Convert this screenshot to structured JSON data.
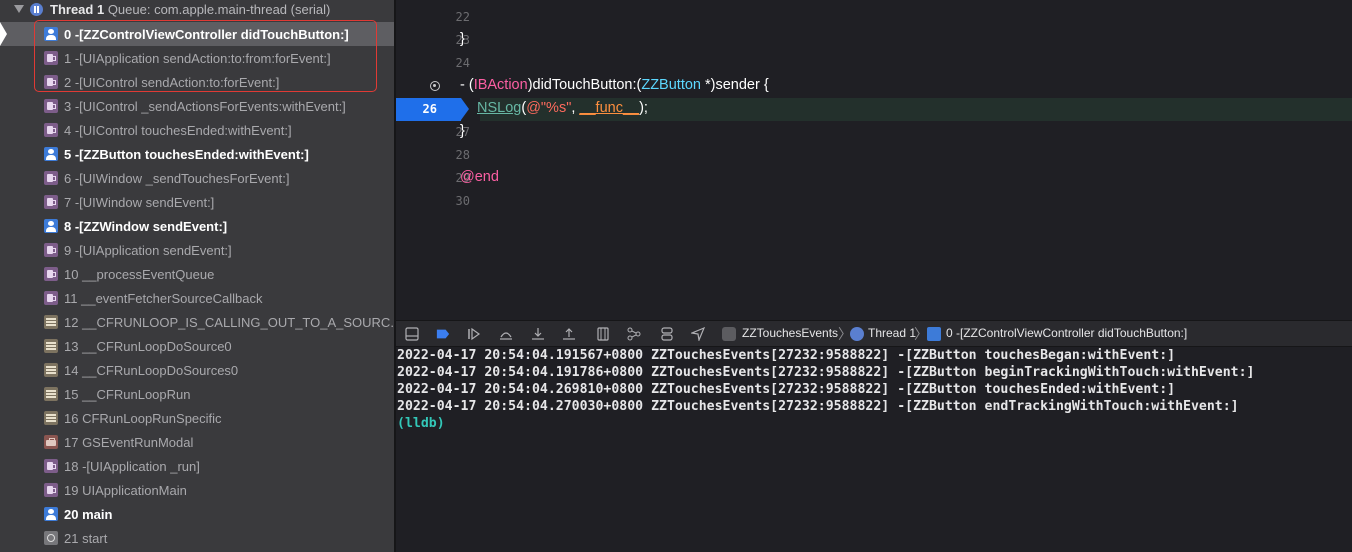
{
  "debug_navigator": {
    "thread": {
      "name": "Thread 1",
      "queue": "Queue: com.apple.main-thread (serial)"
    },
    "frames": [
      {
        "label": "0 -[ZZControlViewController didTouchButton:]",
        "icon": "user-code-icon",
        "bold": true,
        "selected": true
      },
      {
        "label": "1 -[UIApplication sendAction:to:from:forEvent:]",
        "icon": "framework-icon",
        "bold": false
      },
      {
        "label": "2 -[UIControl sendAction:to:forEvent:]",
        "icon": "framework-icon",
        "bold": false
      },
      {
        "label": "3 -[UIControl _sendActionsForEvents:withEvent:]",
        "icon": "framework-icon",
        "bold": false
      },
      {
        "label": "4 -[UIControl touchesEnded:withEvent:]",
        "icon": "framework-icon",
        "bold": false
      },
      {
        "label": "5 -[ZZButton touchesEnded:withEvent:]",
        "icon": "user-code-icon",
        "bold": true
      },
      {
        "label": "6 -[UIWindow _sendTouchesForEvent:]",
        "icon": "framework-icon",
        "bold": false
      },
      {
        "label": "7 -[UIWindow sendEvent:]",
        "icon": "framework-icon",
        "bold": false
      },
      {
        "label": "8 -[ZZWindow sendEvent:]",
        "icon": "user-code-icon",
        "bold": true
      },
      {
        "label": "9 -[UIApplication sendEvent:]",
        "icon": "framework-icon",
        "bold": false
      },
      {
        "label": "10 __processEventQueue",
        "icon": "framework-icon",
        "bold": false
      },
      {
        "label": "11 __eventFetcherSourceCallback",
        "icon": "framework-icon",
        "bold": false
      },
      {
        "label": "12 __CFRUNLOOP_IS_CALLING_OUT_TO_A_SOURC...",
        "icon": "core-foundation-icon",
        "bold": false
      },
      {
        "label": "13 __CFRunLoopDoSource0",
        "icon": "core-foundation-icon",
        "bold": false
      },
      {
        "label": "14 __CFRunLoopDoSources0",
        "icon": "core-foundation-icon",
        "bold": false
      },
      {
        "label": "15 __CFRunLoopRun",
        "icon": "core-foundation-icon",
        "bold": false
      },
      {
        "label": "16 CFRunLoopRunSpecific",
        "icon": "core-foundation-icon",
        "bold": false
      },
      {
        "label": "17 GSEventRunModal",
        "icon": "graphics-services-icon",
        "bold": false
      },
      {
        "label": "18 -[UIApplication _run]",
        "icon": "framework-icon",
        "bold": false
      },
      {
        "label": "19 UIApplicationMain",
        "icon": "framework-icon",
        "bold": false
      },
      {
        "label": "20 main",
        "icon": "user-code-icon",
        "bold": true
      },
      {
        "label": "21 start",
        "icon": "system-gear-icon",
        "bold": false
      }
    ]
  },
  "editor": {
    "lines": [
      {
        "num": "22",
        "code_partial": "}"
      },
      {
        "num": "23",
        "code": "}"
      },
      {
        "num": "24",
        "code": ""
      },
      {
        "num": "25",
        "code_parts": {
          "dash": "- (",
          "ibaction": "IBAction",
          "mid": ")didTouchButton:(",
          "type": "ZZButton",
          "tail": " *)sender {"
        }
      },
      {
        "num": "26",
        "code_parts": {
          "nslog": "NSLog",
          "open": "(",
          "str": "@\"%s\"",
          "comma": ", ",
          "func": "__func__",
          "close": ");"
        }
      },
      {
        "num": "27",
        "code": "}"
      },
      {
        "num": "28",
        "code": ""
      },
      {
        "num": "29",
        "code": "@end"
      },
      {
        "num": "30",
        "code": ""
      }
    ],
    "current_line": "26"
  },
  "debug_bar": {
    "app": "ZZTouchesEvents",
    "thread": "Thread 1",
    "frame": "0 -[ZZControlViewController didTouchButton:]"
  },
  "console": {
    "lines": [
      "2022-04-17 20:54:04.191567+0800 ZZTouchesEvents[27232:9588822] -[ZZButton touchesBegan:withEvent:]",
      "2022-04-17 20:54:04.191786+0800 ZZTouchesEvents[27232:9588822] -[ZZButton beginTrackingWithTouch:withEvent:]",
      "2022-04-17 20:54:04.269810+0800 ZZTouchesEvents[27232:9588822] -[ZZButton touchesEnded:withEvent:]",
      "2022-04-17 20:54:04.270030+0800 ZZTouchesEvents[27232:9588822] -[ZZButton endTrackingWithTouch:withEvent:]"
    ],
    "prompt": "(lldb)"
  },
  "colors": {
    "keyword": "#fc5fa3",
    "type": "#5dd8ff",
    "breakpoint": "#1f6fea",
    "highlight_box": "#e03a35"
  }
}
